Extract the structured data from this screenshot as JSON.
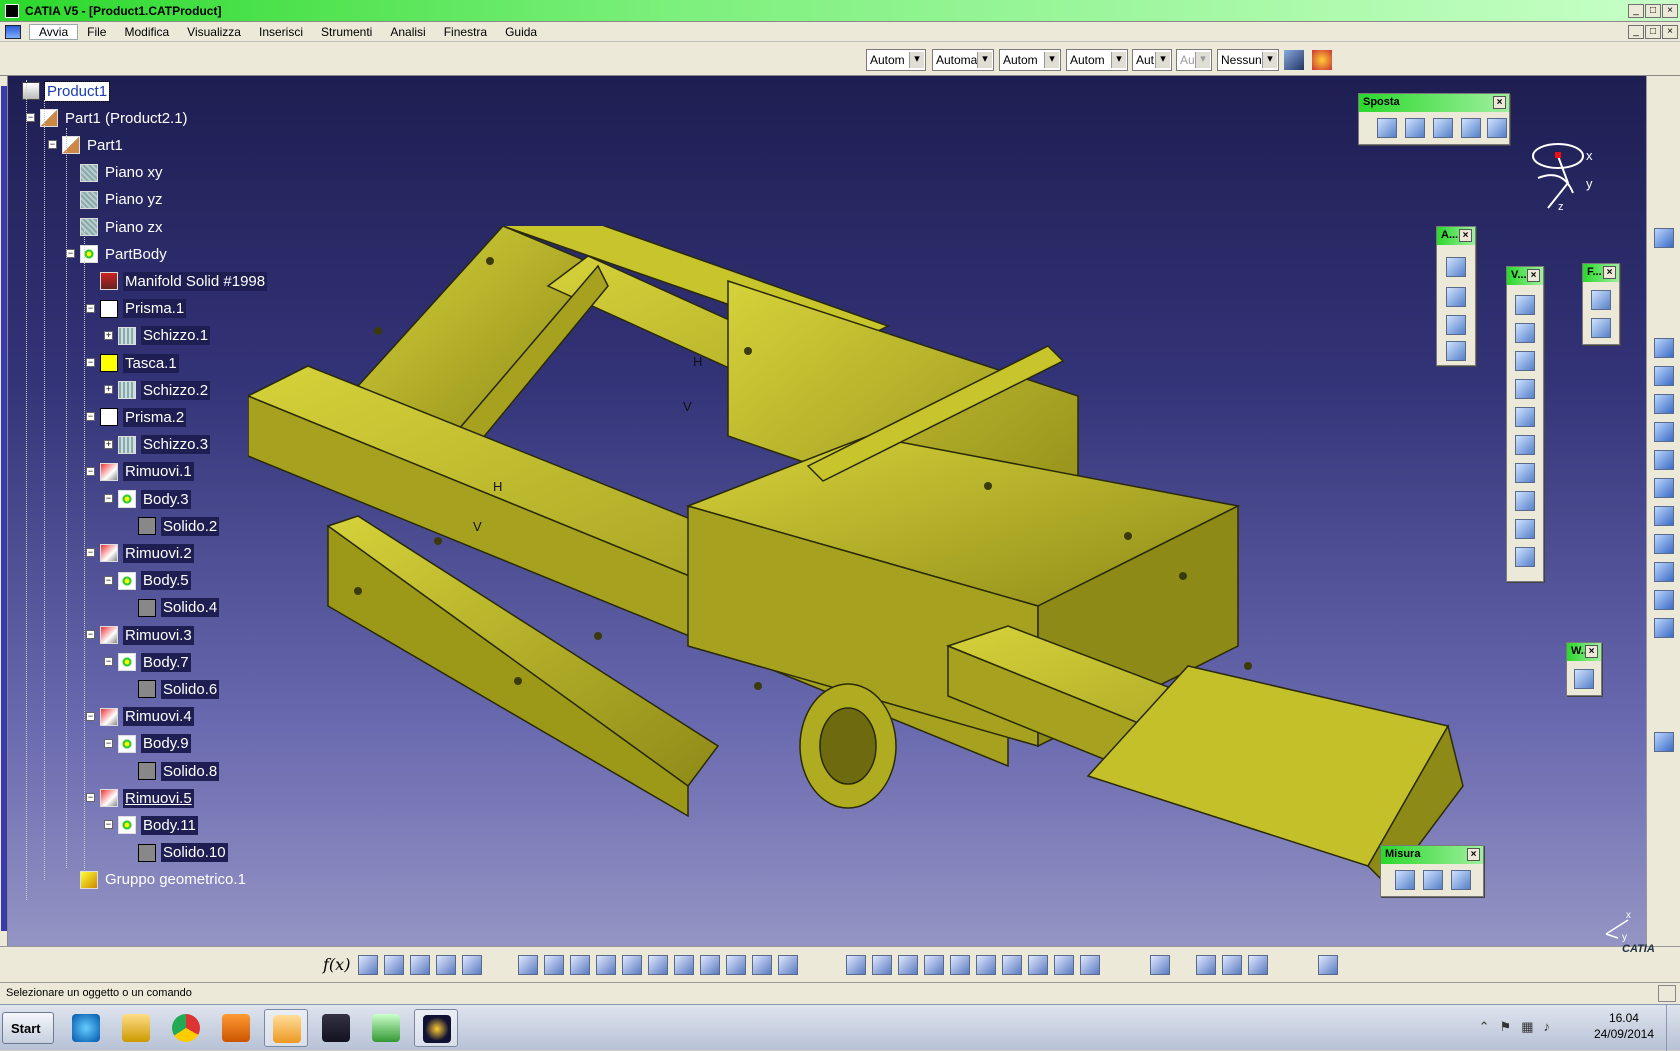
{
  "window": {
    "title": "CATIA V5 - [Product1.CATProduct]",
    "controls": [
      "_",
      "□",
      "×"
    ]
  },
  "menu": {
    "items": [
      "Avvia",
      "File",
      "Modifica",
      "Visualizza",
      "Inserisci",
      "Strumenti",
      "Analisi",
      "Finestra",
      "Guida"
    ]
  },
  "toolbar": {
    "dropdowns": [
      "Autom",
      "Automa",
      "Autom",
      "Autom",
      "Aut",
      "Aut",
      "Nessun"
    ]
  },
  "tree": {
    "items": [
      {
        "label": "Product1",
        "icon": "product-icon"
      },
      {
        "label": "Part1 (Product2.1)",
        "icon": "part-icon"
      },
      {
        "label": "Part1",
        "icon": "part-icon"
      },
      {
        "label": "Piano xy",
        "icon": "plane-icon"
      },
      {
        "label": "Piano yz",
        "icon": "plane-icon"
      },
      {
        "label": "Piano zx",
        "icon": "plane-icon"
      },
      {
        "label": "PartBody",
        "icon": "body-icon"
      },
      {
        "label": "Manifold Solid #1998",
        "icon": "solid-icon"
      },
      {
        "label": "Prisma.1",
        "icon": "pad-icon"
      },
      {
        "label": "Schizzo.1",
        "icon": "sketch-icon"
      },
      {
        "label": "Tasca.1",
        "icon": "pocket-icon"
      },
      {
        "label": "Schizzo.2",
        "icon": "sketch-icon"
      },
      {
        "label": "Prisma.2",
        "icon": "pad-icon"
      },
      {
        "label": "Schizzo.3",
        "icon": "sketch-icon"
      },
      {
        "label": "Rimuovi.1",
        "icon": "remove-icon"
      },
      {
        "label": "Body.3",
        "icon": "body-icon"
      },
      {
        "label": "Solido.2",
        "icon": "solid-icon"
      },
      {
        "label": "Rimuovi.2",
        "icon": "remove-icon"
      },
      {
        "label": "Body.5",
        "icon": "body-icon"
      },
      {
        "label": "Solido.4",
        "icon": "solid-icon"
      },
      {
        "label": "Rimuovi.3",
        "icon": "remove-icon"
      },
      {
        "label": "Body.7",
        "icon": "body-icon"
      },
      {
        "label": "Solido.6",
        "icon": "solid-icon"
      },
      {
        "label": "Rimuovi.4",
        "icon": "remove-icon"
      },
      {
        "label": "Body.9",
        "icon": "body-icon"
      },
      {
        "label": "Solido.8",
        "icon": "solid-icon"
      },
      {
        "label": "Rimuovi.5",
        "icon": "remove-icon"
      },
      {
        "label": "Body.11",
        "icon": "body-icon"
      },
      {
        "label": "Solido.10",
        "icon": "solid-icon"
      },
      {
        "label": "Gruppo geometrico.1",
        "icon": "geometric-set-icon"
      }
    ]
  },
  "toolbars": {
    "sposta": "Sposta",
    "a": "A...",
    "v": "V...",
    "f": "F...",
    "w": "W...",
    "misura": "Misura"
  },
  "axis": {
    "x": "x",
    "y": "y",
    "z": "z"
  },
  "model_labels": {
    "h1": "H",
    "v1": "V",
    "h2": "H",
    "v2": "V"
  },
  "status": {
    "text": "Selezionare un oggetto o un comando"
  },
  "taskbar": {
    "start": "Start",
    "time": "16.04",
    "date": "24/09/2014"
  },
  "brand": {
    "catia": "CATIA"
  },
  "colors": {
    "model": "#b8b42a",
    "background_top": "#1e1e52",
    "background_bottom": "#9494c4",
    "titlebar": "#2bd82b"
  }
}
